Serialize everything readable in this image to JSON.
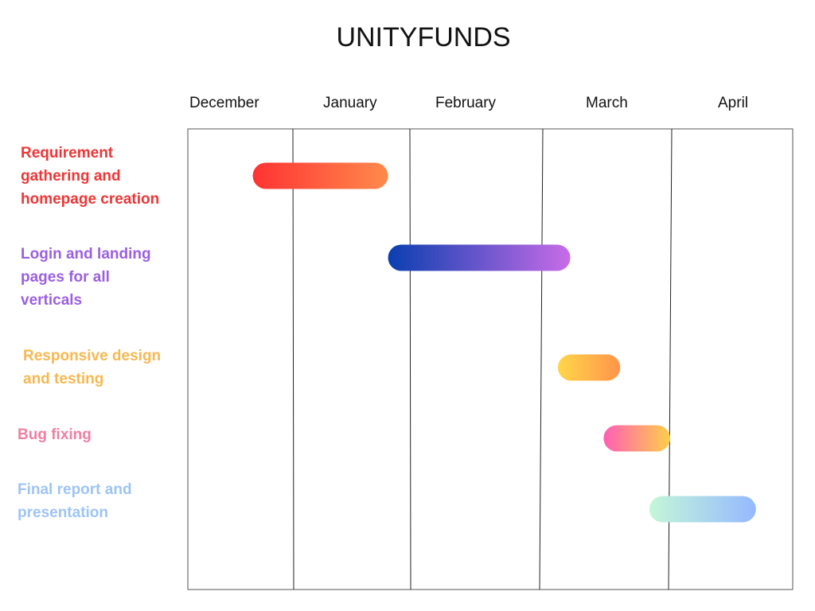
{
  "title": "UNITYFUNDS",
  "chart_data": {
    "type": "gantt",
    "title": "UNITYFUNDS",
    "months": [
      "December",
      "January",
      "February",
      "March",
      "April"
    ],
    "x_domain": [
      "2023-12-01",
      "2024-05-01"
    ],
    "grid": true,
    "tasks": [
      {
        "name": "Requirement gathering and homepage creation",
        "label_lines": [
          "Requirement",
          "gathering and",
          "homepage creation"
        ],
        "start": "2023-12-20",
        "end": "2024-01-26",
        "color": "#ef3535",
        "gradient": [
          "#ff3333",
          "#ff8a4c"
        ]
      },
      {
        "name": "Login and landing pages for all verticals",
        "label_lines": [
          "Login and landing",
          "pages for all",
          "verticals"
        ],
        "start": "2024-01-26",
        "end": "2024-03-08",
        "color": "#9b5fe0",
        "gradient": [
          "#0a3fb0",
          "#c86ce8"
        ]
      },
      {
        "name": "Responsive design and testing",
        "label_lines": [
          "Responsive design",
          "and testing"
        ],
        "start": "2024-03-05",
        "end": "2024-03-20",
        "color": "#f7b84f",
        "gradient": [
          "#ffd64a",
          "#ff944a"
        ]
      },
      {
        "name": "Bug fixing",
        "label_lines": [
          "Bug fixing"
        ],
        "start": "2024-03-16",
        "end": "2024-04-01",
        "color": "#f07fa0",
        "gradient": [
          "#ff5fb4",
          "#ffcf4a"
        ]
      },
      {
        "name": "Final report and presentation",
        "label_lines": [
          "Final report and",
          "presentation"
        ],
        "start": "2024-03-27",
        "end": "2024-04-22",
        "color": "#9ec4f5",
        "gradient": [
          "#c4f7d8",
          "#95b9ff"
        ]
      }
    ]
  }
}
